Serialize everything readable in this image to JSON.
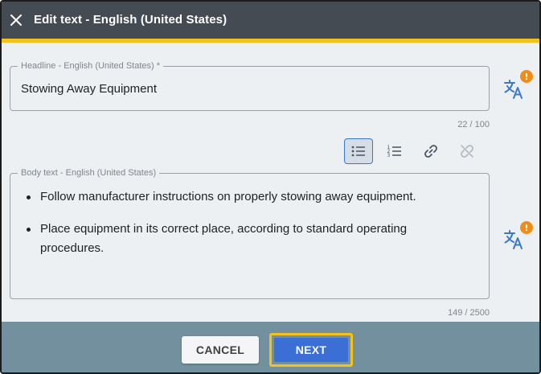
{
  "header": {
    "title": "Edit text - English (United States)",
    "close_icon": "close-icon",
    "accent_color": "#f5c21b"
  },
  "headline": {
    "label": "Headline - English (United States) *",
    "value": "Stowing Away Equipment",
    "counter": "22 / 100"
  },
  "toolbar": {
    "buttons": [
      {
        "icon": "bulleted-list-icon",
        "active": true
      },
      {
        "icon": "numbered-list-icon",
        "active": false
      },
      {
        "icon": "link-icon",
        "active": false
      },
      {
        "icon": "unlink-icon",
        "active": false
      }
    ]
  },
  "body": {
    "label": "Body text - English (United States)",
    "items": [
      "Follow manufacturer instructions on properly stowing away equipment.",
      "Place equipment in its correct place, according to standard operating procedures."
    ],
    "counter": "149 / 2500"
  },
  "translate": {
    "icon": "translate-icon",
    "warning_badge": "!",
    "warning_color": "#f28c18"
  },
  "footer": {
    "cancel_label": "CANCEL",
    "next_label": "NEXT",
    "next_color": "#3c6fd6"
  }
}
